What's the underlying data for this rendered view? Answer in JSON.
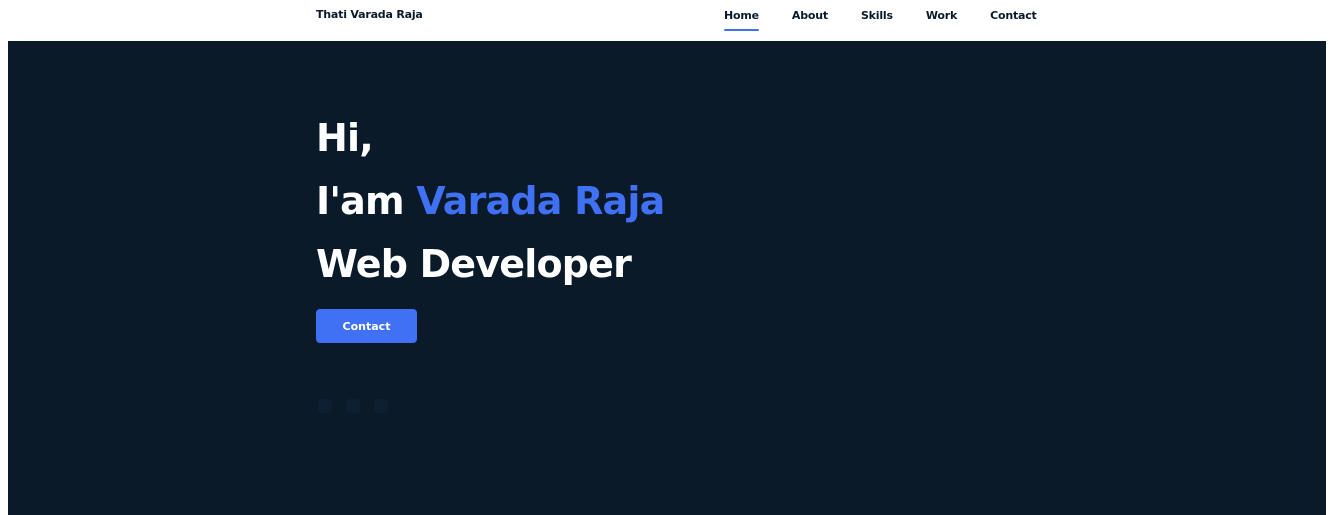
{
  "header": {
    "brand": "Thati Varada Raja",
    "nav": [
      {
        "label": "Home",
        "active": true
      },
      {
        "label": "About",
        "active": false
      },
      {
        "label": "Skills",
        "active": false
      },
      {
        "label": "Work",
        "active": false
      },
      {
        "label": "Contact",
        "active": false
      }
    ]
  },
  "hero": {
    "greeting": "Hi,",
    "intro_prefix": "I'am",
    "name": "Varada Raja",
    "role": "Web Developer",
    "cta_label": "Contact",
    "social_icons": [
      "social-icon-1",
      "social-icon-2",
      "social-icon-3"
    ]
  },
  "colors": {
    "accent": "#4070f4",
    "hero_background": "#0a1a29",
    "header_background": "#ffffff",
    "text_dark": "#0b1a2a",
    "text_light": "#ffffff"
  }
}
